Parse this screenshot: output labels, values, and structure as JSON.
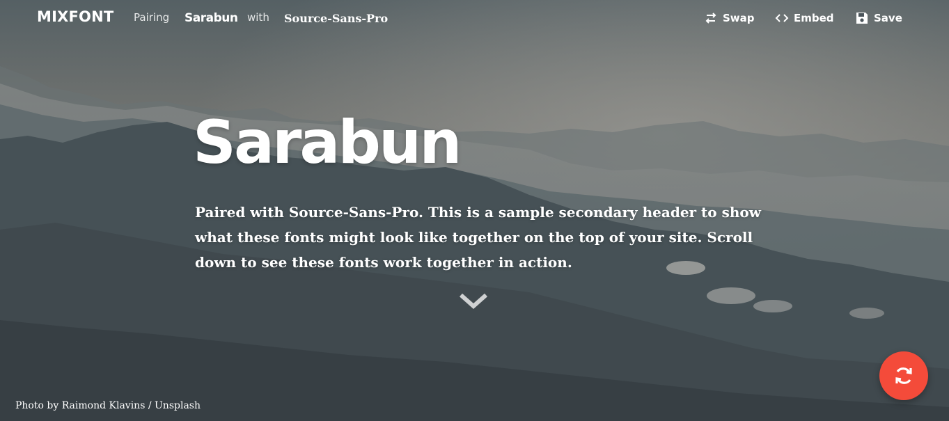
{
  "nav": {
    "brand": "MIXFONT",
    "pairing_label": "Pairing",
    "header_font": "Sarabun",
    "with_label": "with",
    "body_font": "Source-Sans-Pro",
    "actions": [
      {
        "label": "Swap",
        "icon": "swap-icon"
      },
      {
        "label": "Embed",
        "icon": "code-icon"
      },
      {
        "label": "Save",
        "icon": "floppy-disk-icon"
      }
    ]
  },
  "hero": {
    "title": "Sarabun",
    "subtitle": "Paired with Source-Sans-Pro. This is a sample secondary header to show what these fonts might look like together on the top of your site. Scroll down to see these fonts work together in action.",
    "scroll_icon": "chevron-down-icon"
  },
  "credit": "Photo by Raimond Klavins / Unsplash",
  "fab": {
    "icon": "refresh-icon",
    "color": "#f44b3a"
  }
}
